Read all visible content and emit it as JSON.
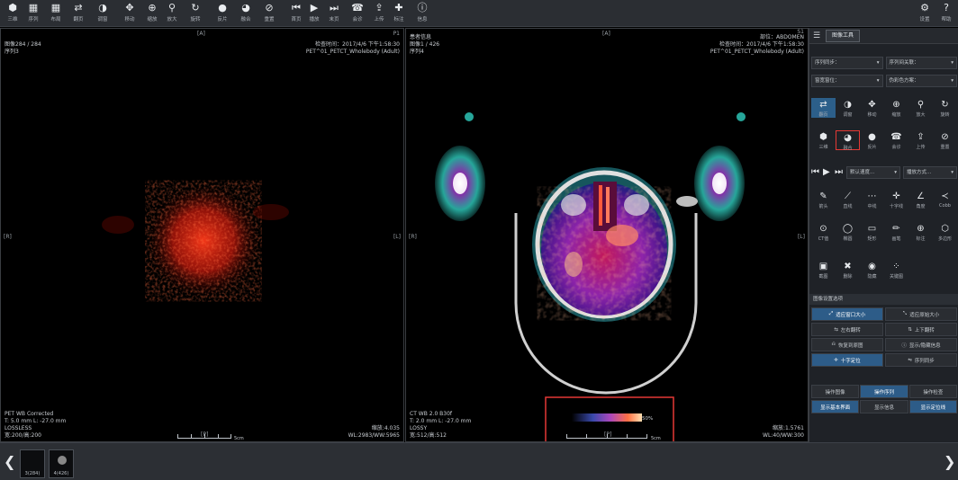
{
  "toolbar": {
    "left_buttons": [
      {
        "label": "三维",
        "icon": "cube-icon",
        "glyph": "⬢"
      },
      {
        "label": "序列",
        "icon": "series-grid-icon",
        "glyph": "▦"
      },
      {
        "label": "布局",
        "icon": "layout-icon",
        "glyph": "▦"
      },
      {
        "label": "翻页",
        "icon": "swap-icon",
        "glyph": "⇄"
      },
      {
        "label": "调窗",
        "icon": "contrast-icon",
        "glyph": "◑"
      },
      {
        "label": "移动",
        "icon": "move-icon",
        "glyph": "✥"
      },
      {
        "label": "缩放",
        "icon": "zoom-in-icon",
        "glyph": "⊕"
      },
      {
        "label": "放大",
        "icon": "magnify-icon",
        "glyph": "⚲"
      },
      {
        "label": "旋转",
        "icon": "rotate-icon",
        "glyph": "↻"
      },
      {
        "label": "反片",
        "icon": "invert-icon",
        "glyph": "●"
      },
      {
        "label": "融合",
        "icon": "fusion-icon",
        "glyph": "◕"
      },
      {
        "label": "重置",
        "icon": "reset-icon",
        "glyph": "⊘"
      },
      {
        "label": "首页",
        "icon": "first-frame-icon",
        "glyph": "⏮"
      },
      {
        "label": "播放",
        "icon": "play-icon",
        "glyph": "▶"
      },
      {
        "label": "末页",
        "icon": "last-frame-icon",
        "glyph": "⏭"
      },
      {
        "label": "会诊",
        "icon": "telephone-icon",
        "glyph": "☎"
      },
      {
        "label": "上传",
        "icon": "upload-icon",
        "glyph": "⇪"
      },
      {
        "label": "标注",
        "icon": "plus-icon",
        "glyph": "✚"
      },
      {
        "label": "信息",
        "icon": "info-icon",
        "glyph": "ⓘ"
      }
    ],
    "right_buttons": [
      {
        "label": "设置",
        "icon": "gear-icon",
        "glyph": "⚙"
      },
      {
        "label": "帮助",
        "icon": "help-icon",
        "glyph": "?"
      }
    ]
  },
  "viewport_left": {
    "top_left": [
      "图像284 / 284",
      "序列3"
    ],
    "top_right": [
      "检查时间：2017/4/6 下午1:58:30",
      "PET^01_PETCT_Wholebody (Adult)"
    ],
    "bottom_left": [
      "PET WB Corrected",
      "T: 5.0 mm L: -27.0 mm",
      "LOSSLESS",
      "宽:200/高:200"
    ],
    "bottom_right": [
      "缩放:4.035",
      "WL:2983/WW:5965"
    ],
    "orient_top": "[A]",
    "orient_left": "[R]",
    "orient_right": "[L]",
    "orient_bottom": "[P]",
    "corner_tr": "P1",
    "scale_unit": "5cm"
  },
  "viewport_right": {
    "top_left": [
      "患者信息",
      "图像1 / 426",
      "序列4"
    ],
    "top_right": [
      "部位：ABDOMEN",
      "检查时间：2017/4/6 下午1:58:30",
      "PET^01_PETCT_Wholebody (Adult)"
    ],
    "bottom_left": [
      "CT WB 2.0 B30f",
      "T: 2.0 mm L: -27.0 mm",
      "LOSSY",
      "宽:512/高:512"
    ],
    "bottom_right": [
      "缩放:1.5761",
      "WL:40/WW:300"
    ],
    "orient_top": "[A]",
    "orient_left": "[R]",
    "orient_right": "[L]",
    "orient_bottom": "[P]",
    "corner_tr": "S1",
    "colorbar_label": "50%",
    "scale_unit": "5cm"
  },
  "panel": {
    "tab_label": "图像工具",
    "selects": [
      {
        "label": "序列同步：",
        "value": "▾"
      },
      {
        "label": "序列间关联：",
        "value": "▾"
      },
      {
        "label": "窗宽窗位：",
        "value": "▾"
      },
      {
        "label": "伪彩色方案：",
        "value": "▾"
      }
    ],
    "tools_row1": [
      {
        "label": "翻页",
        "icon": "swap-icon",
        "glyph": "⇄",
        "state": "sel"
      },
      {
        "label": "调窗",
        "icon": "contrast-icon",
        "glyph": "◑",
        "state": ""
      },
      {
        "label": "移动",
        "icon": "move-icon",
        "glyph": "✥",
        "state": ""
      },
      {
        "label": "缩放",
        "icon": "zoom-in-icon",
        "glyph": "⊕",
        "state": ""
      },
      {
        "label": "放大",
        "icon": "magnify-icon",
        "glyph": "⚲",
        "state": ""
      }
    ],
    "tools_row1b": [
      {
        "label": "旋转",
        "icon": "rotate-icon",
        "glyph": "↻",
        "state": ""
      }
    ],
    "tools_row2": [
      {
        "label": "三维",
        "icon": "cube-icon",
        "glyph": "⬢",
        "state": ""
      },
      {
        "label": "融合",
        "icon": "fusion-icon",
        "glyph": "◕",
        "state": "active"
      },
      {
        "label": "反片",
        "icon": "invert-icon",
        "glyph": "●",
        "state": ""
      },
      {
        "label": "会诊",
        "icon": "telephone-icon",
        "glyph": "☎",
        "state": ""
      },
      {
        "label": "上传",
        "icon": "upload-icon",
        "glyph": "⇪",
        "state": ""
      }
    ],
    "tools_row2b": [
      {
        "label": "重置",
        "icon": "reset-icon",
        "glyph": "⊘",
        "state": ""
      }
    ],
    "play_select_1": "默认速度...",
    "play_select_2": "播放方式...",
    "measure_row1": [
      {
        "label": "箭头",
        "icon": "pin-icon",
        "glyph": "✎"
      },
      {
        "label": "直线",
        "icon": "line-icon",
        "glyph": "⟋"
      },
      {
        "label": "中线",
        "icon": "midline-icon",
        "glyph": "⋯"
      },
      {
        "label": "十字线",
        "icon": "crosshair-icon",
        "glyph": "✛"
      },
      {
        "label": "角度",
        "icon": "angle-icon",
        "glyph": "∠"
      },
      {
        "label": "Cobb",
        "icon": "cobb-icon",
        "glyph": "≺"
      }
    ],
    "measure_row2": [
      {
        "label": "CT值",
        "icon": "target-icon",
        "glyph": "⊙"
      },
      {
        "label": "椭圆",
        "icon": "ellipse-icon",
        "glyph": "◯"
      },
      {
        "label": "矩形",
        "icon": "rect-icon",
        "glyph": "▭"
      },
      {
        "label": "画笔",
        "icon": "pencil-icon",
        "glyph": "✏"
      },
      {
        "label": "标注",
        "icon": "globe-icon",
        "glyph": "⊕"
      },
      {
        "label": "多边形",
        "icon": "polygon-icon",
        "glyph": "⬡"
      }
    ],
    "measure_row3": [
      {
        "label": "截图",
        "icon": "camera-icon",
        "glyph": "▣"
      },
      {
        "label": "删除",
        "icon": "delete-icon",
        "glyph": "✖"
      },
      {
        "label": "隐藏",
        "icon": "hide-icon",
        "glyph": "◉"
      },
      {
        "label": "关键图",
        "icon": "keyimage-icon",
        "glyph": "⁘"
      }
    ],
    "section_title": "图像设置选项",
    "options": [
      {
        "label": "适应窗口大小",
        "icon": "resize-icon",
        "glyph": "⤢",
        "on": true
      },
      {
        "label": "适应原始大小",
        "icon": "resize-icon",
        "glyph": "⤡",
        "on": false
      },
      {
        "label": "左右翻转",
        "icon": "flip-icon",
        "glyph": "⇆",
        "on": false
      },
      {
        "label": "上下翻转",
        "icon": "flip-icon",
        "glyph": "⇅",
        "on": false
      },
      {
        "label": "恢复到原图",
        "icon": "restore-icon",
        "glyph": "⎌",
        "on": false
      },
      {
        "label": "显示/隐藏信息",
        "icon": "info-icon",
        "glyph": "ⓘ",
        "on": false
      },
      {
        "label": "十字定位",
        "icon": "locate-icon",
        "glyph": "✛",
        "on": true
      },
      {
        "label": "序列同步",
        "icon": "sync-icon",
        "glyph": "⇋",
        "on": false
      }
    ],
    "tabs": [
      {
        "label": "操作图像",
        "on": false
      },
      {
        "label": "操作序列",
        "on": true
      },
      {
        "label": "操作检查",
        "on": false
      }
    ],
    "bottom_buttons": [
      {
        "label": "显示基本界面",
        "on": true
      },
      {
        "label": "显示信息",
        "on": false
      },
      {
        "label": "显示定位线",
        "on": true
      }
    ]
  },
  "bottom": {
    "thumbs": [
      "3(284)",
      "4(426)"
    ]
  }
}
